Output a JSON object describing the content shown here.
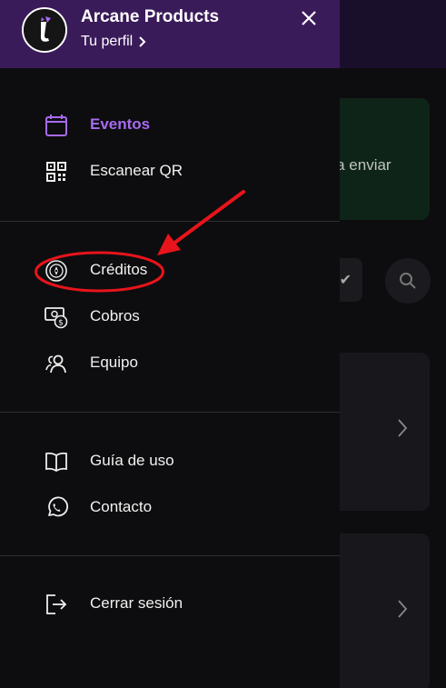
{
  "background": {
    "banner_text": "ara enviar"
  },
  "drawer": {
    "org_name": "Arcane Products",
    "profile_link": "Tu perfil",
    "menu_primary": [
      {
        "label": "Eventos",
        "icon": "calendar-icon",
        "active": true
      },
      {
        "label": "Escanear QR",
        "icon": "qr-code-icon",
        "active": false
      }
    ],
    "menu_finance": [
      {
        "label": "Créditos",
        "icon": "coin-icon"
      },
      {
        "label": "Cobros",
        "icon": "cash-payment-icon"
      },
      {
        "label": "Equipo",
        "icon": "team-users-icon"
      }
    ],
    "menu_help": [
      {
        "label": "Guía de uso",
        "icon": "book-icon"
      },
      {
        "label": "Contacto",
        "icon": "whatsapp-icon"
      }
    ],
    "logout_label": "Cerrar sesión"
  },
  "colors": {
    "header_bg": "#3a1b5a",
    "accent": "#a66bf0",
    "annotation": "#e8141b"
  }
}
